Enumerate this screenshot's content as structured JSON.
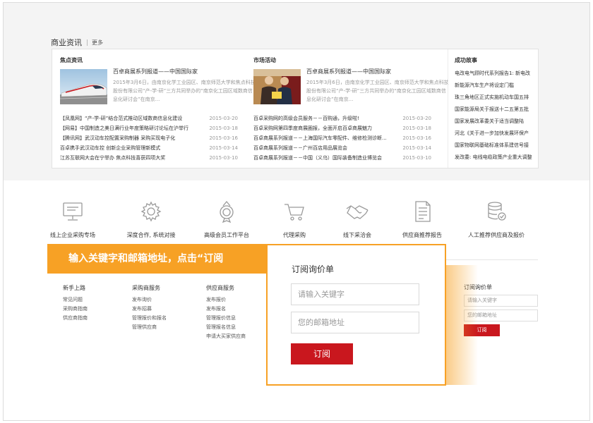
{
  "news": {
    "section_title": "商业资讯",
    "more": "更多",
    "columns": [
      {
        "title": "焦点资讯",
        "feature_title": "百卓商展系列报道——中国国际家",
        "feature_desc": "2015年3月6日，由南京化学工业园区、南京师范大学和焦点科技股份有限公司“产-学-研”三方共同举办的“南京化工园区域数商信息化研讨会”在南京...",
        "items": [
          {
            "t": "【凤凰网】“产-学-研”结合范式推动区域数商信息化建设",
            "d": "2015-03-20"
          },
          {
            "t": "【网易】中国制造之美日满行业年度策略研讨论坛在沪举行",
            "d": "2015-03-18"
          },
          {
            "t": "【腾讯网】武汉动车控配置采购制器 采购买现电子化",
            "d": "2015-03-16"
          },
          {
            "t": "百卓携手武汉动车控 创新企业采购管理新模式",
            "d": "2015-03-14"
          },
          {
            "t": "江苏互联网大会在宁举办 焦点科技喜获四项大奖",
            "d": "2015-03-10"
          }
        ]
      },
      {
        "title": "市场活动",
        "feature_title": "百卓商展系列报道——中国国际家",
        "feature_desc": "2015年3月6日，由南京化学工业园区、南京师范大学和焦点科技股份有限公司“产-学-研”三方共同举办的“南京化工园区域数商信息化研讨会”在南京...",
        "items": [
          {
            "t": "百卓采购网的高级会员服务－－百购通，升级啦!",
            "d": "2015-03-20"
          },
          {
            "t": "百卓采购网第四季度商展圈报，全面开启百卓商展魅力",
            "d": "2015-03-18"
          },
          {
            "t": "百卓商展系列报道－－上海国际汽车零配件、维修检测诊断...",
            "d": "2015-03-16"
          },
          {
            "t": "百卓商展系列报道－－广州百店用品展览会",
            "d": "2015-03-14"
          },
          {
            "t": "百卓商展系列报道－－中国（义乌）国际装备制造业博览会",
            "d": "2015-03-10"
          }
        ]
      }
    ],
    "stories": {
      "title": "成功故事",
      "items": [
        "电改电气顾时代系列报告1: 新电改",
        "新能源汽车生产将设定门槛",
        "珠三角地区正式实施机动车国五排",
        "国家能源局关于报送十二五第五批",
        "国家发展改革委关于适当调整陆",
        "河北《关于进一步加快发展环保产",
        "国家物联网基础标准体系建信号接",
        "发改委: 电线电缆政策产业重大调整"
      ]
    }
  },
  "services": [
    {
      "label": "线上企业采购专场",
      "icon": "monitor-icon"
    },
    {
      "label": "深度合作, 系统对接",
      "icon": "gear-icon"
    },
    {
      "label": "高级会员工作平台",
      "icon": "medal-icon"
    },
    {
      "label": "代理采购",
      "icon": "cart-icon"
    },
    {
      "label": "线下采洽会",
      "icon": "handshake-icon"
    },
    {
      "label": "供应商推荐报告",
      "icon": "report-icon"
    },
    {
      "label": "人工推荐供应商及报价",
      "icon": "database-check-icon"
    }
  ],
  "footer": {
    "columns": [
      {
        "title": "新手上路",
        "links": [
          "常见问题",
          "采购商指南",
          "供应商指南"
        ]
      },
      {
        "title": "采购商服务",
        "links": [
          "发布询价",
          "发布招募",
          "管理报价和报名",
          "管理供应商"
        ]
      },
      {
        "title": "供应商服务",
        "links": [
          "发布报价",
          "发布报名",
          "管理报价信息",
          "管理报名信息",
          "申请大买家供应商"
        ]
      }
    ],
    "mini_subscribe": {
      "title": "订阅询价单",
      "keyword_placeholder": "请输入关键字",
      "email_placeholder": "您的邮箱地址",
      "button": "订阅"
    }
  },
  "overlay": {
    "banner_text": "输入关键字和邮箱地址，点击“订阅",
    "title": "订阅询价单",
    "keyword_placeholder": "请输入关键字",
    "email_placeholder": "您的邮箱地址",
    "button": "订阅"
  },
  "colors": {
    "accent": "#f7a125",
    "brand_red": "#c9171e",
    "grey_bg": "#f4f4f4"
  }
}
